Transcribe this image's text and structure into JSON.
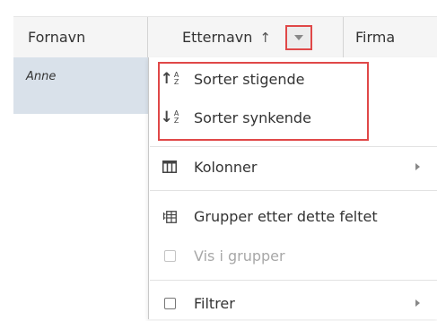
{
  "grid": {
    "columns": [
      {
        "label": "Fornavn"
      },
      {
        "label": "Etternavn",
        "sort_indicator": "↑"
      },
      {
        "label": "Firma"
      }
    ],
    "rows": [
      {
        "fornavn": "Anne"
      }
    ]
  },
  "menu": {
    "sort_asc": "Sorter stigende",
    "sort_desc": "Sorter synkende",
    "columns": "Kolonner",
    "group_by": "Grupper etter dette feltet",
    "show_in_groups": "Vis i grupper",
    "filter": "Filtrer"
  },
  "colors": {
    "highlight": "#e04848",
    "header_bg": "#f5f5f5",
    "selected_row": "#d9e1ea"
  }
}
